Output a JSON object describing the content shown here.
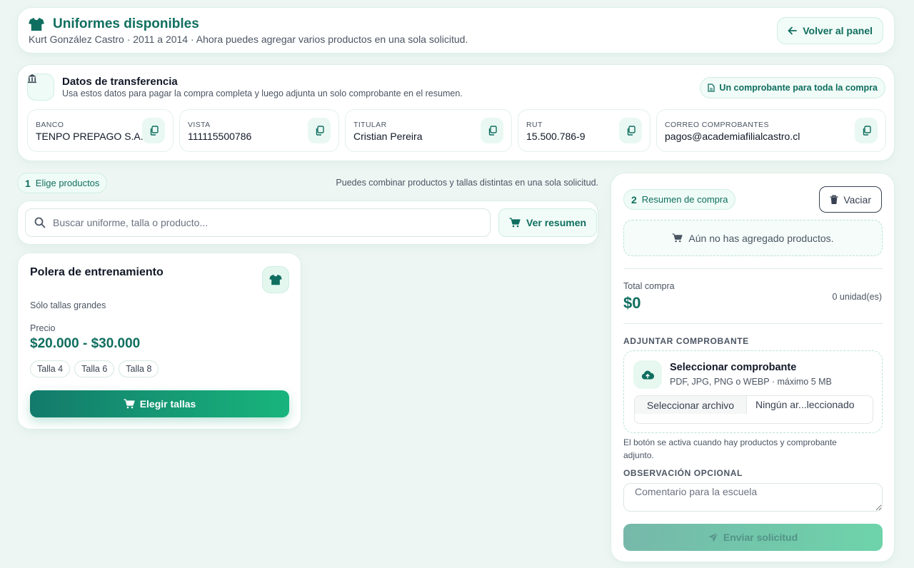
{
  "header": {
    "title": "Uniformes disponibles",
    "subtitle": "Kurt González Castro · 2011 a 2014 · Ahora puedes agregar varios productos en una sola solicitud.",
    "back_label": "Volver al panel",
    "icon": "tshirt-icon"
  },
  "transfer": {
    "title": "Datos de transferencia",
    "subtitle": "Usa estos datos para pagar la compra completa y luego adjunta un solo comprobante en el resumen.",
    "pill": "Un comprobante para toda la compra",
    "fields": [
      {
        "label": "Banco",
        "value": "TENPO PREPAGO S.A."
      },
      {
        "label": "Vista",
        "value": "111115500786"
      },
      {
        "label": "Titular",
        "value": "Cristian Pereira"
      },
      {
        "label": "RUT",
        "value": "15.500.786-9"
      },
      {
        "label": "Correo comprobantes",
        "value": "pagos@academiafilialcastro.cl"
      }
    ]
  },
  "step1": {
    "number": "1",
    "label": "Elige productos",
    "hint": "Puedes combinar productos y tallas distintas en una sola solicitud.",
    "search_placeholder": "Buscar uniforme, talla o producto...",
    "summary_button": "Ver resumen"
  },
  "product": {
    "name": "Polera de entrenamiento",
    "note": "Sólo tallas grandes",
    "price_label": "Precio",
    "price": "$20.000 - $30.000",
    "sizes": [
      "Talla 4",
      "Talla 6",
      "Talla 8"
    ],
    "button": "Elegir tallas"
  },
  "summary": {
    "number": "2",
    "label": "Resumen de compra",
    "clear": "Vaciar",
    "empty": "Aún no has agregado productos.",
    "total_label": "Total compra",
    "total_value": "$0",
    "units": "0 unidad(es)",
    "attach_label": "Adjuntar comprobante",
    "upload_title": "Seleccionar comprobante",
    "upload_sub": "PDF, JPG, PNG o WEBP · máximo 5 MB",
    "file_button": "Seleccionar archivo",
    "file_status": "Ningún ar...leccionado",
    "note": "El botón se activa cuando hay productos y comprobante adjunto.",
    "obs_label": "Observación opcional",
    "obs_placeholder": "Comentario para la escuela",
    "send": "Enviar solicitud"
  },
  "colors": {
    "accent": "#0f6e5f",
    "accent_light": "#18b57c",
    "background": "#eef6f3"
  }
}
